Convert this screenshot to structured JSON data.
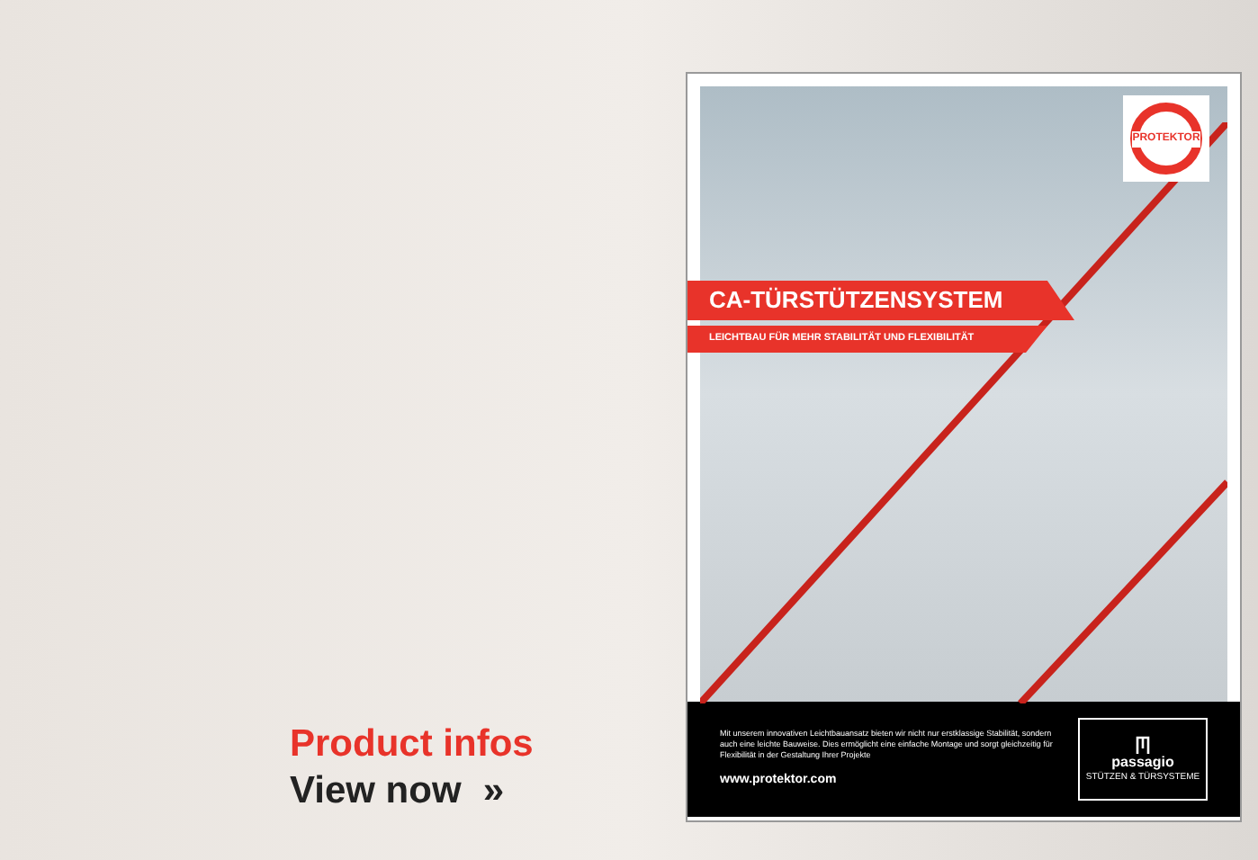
{
  "promo": {
    "title": "Product infos",
    "link": "View now",
    "link_icon": "»"
  },
  "brochure": {
    "logo": "PROTEKTOR",
    "heading": "CA-TÜRSTÜTZENSYSTEM",
    "subheading": "LEICHTBAU FÜR MEHR STABILITÄT UND FLEXIBILITÄT",
    "body": "Mit unserem innovativen Leichtbauansatz bieten wir nicht nur erstklassige Stabilität, sondern auch eine leichte Bauweise. Dies ermöglicht eine einfache Montage und sorgt gleichzeitig für Flexibilität in der Gestaltung Ihrer Projekte",
    "url": "www.protektor.com",
    "partner_logo": "passagio",
    "partner_tagline": "STÜTZEN & TÜRSYSTEME"
  }
}
